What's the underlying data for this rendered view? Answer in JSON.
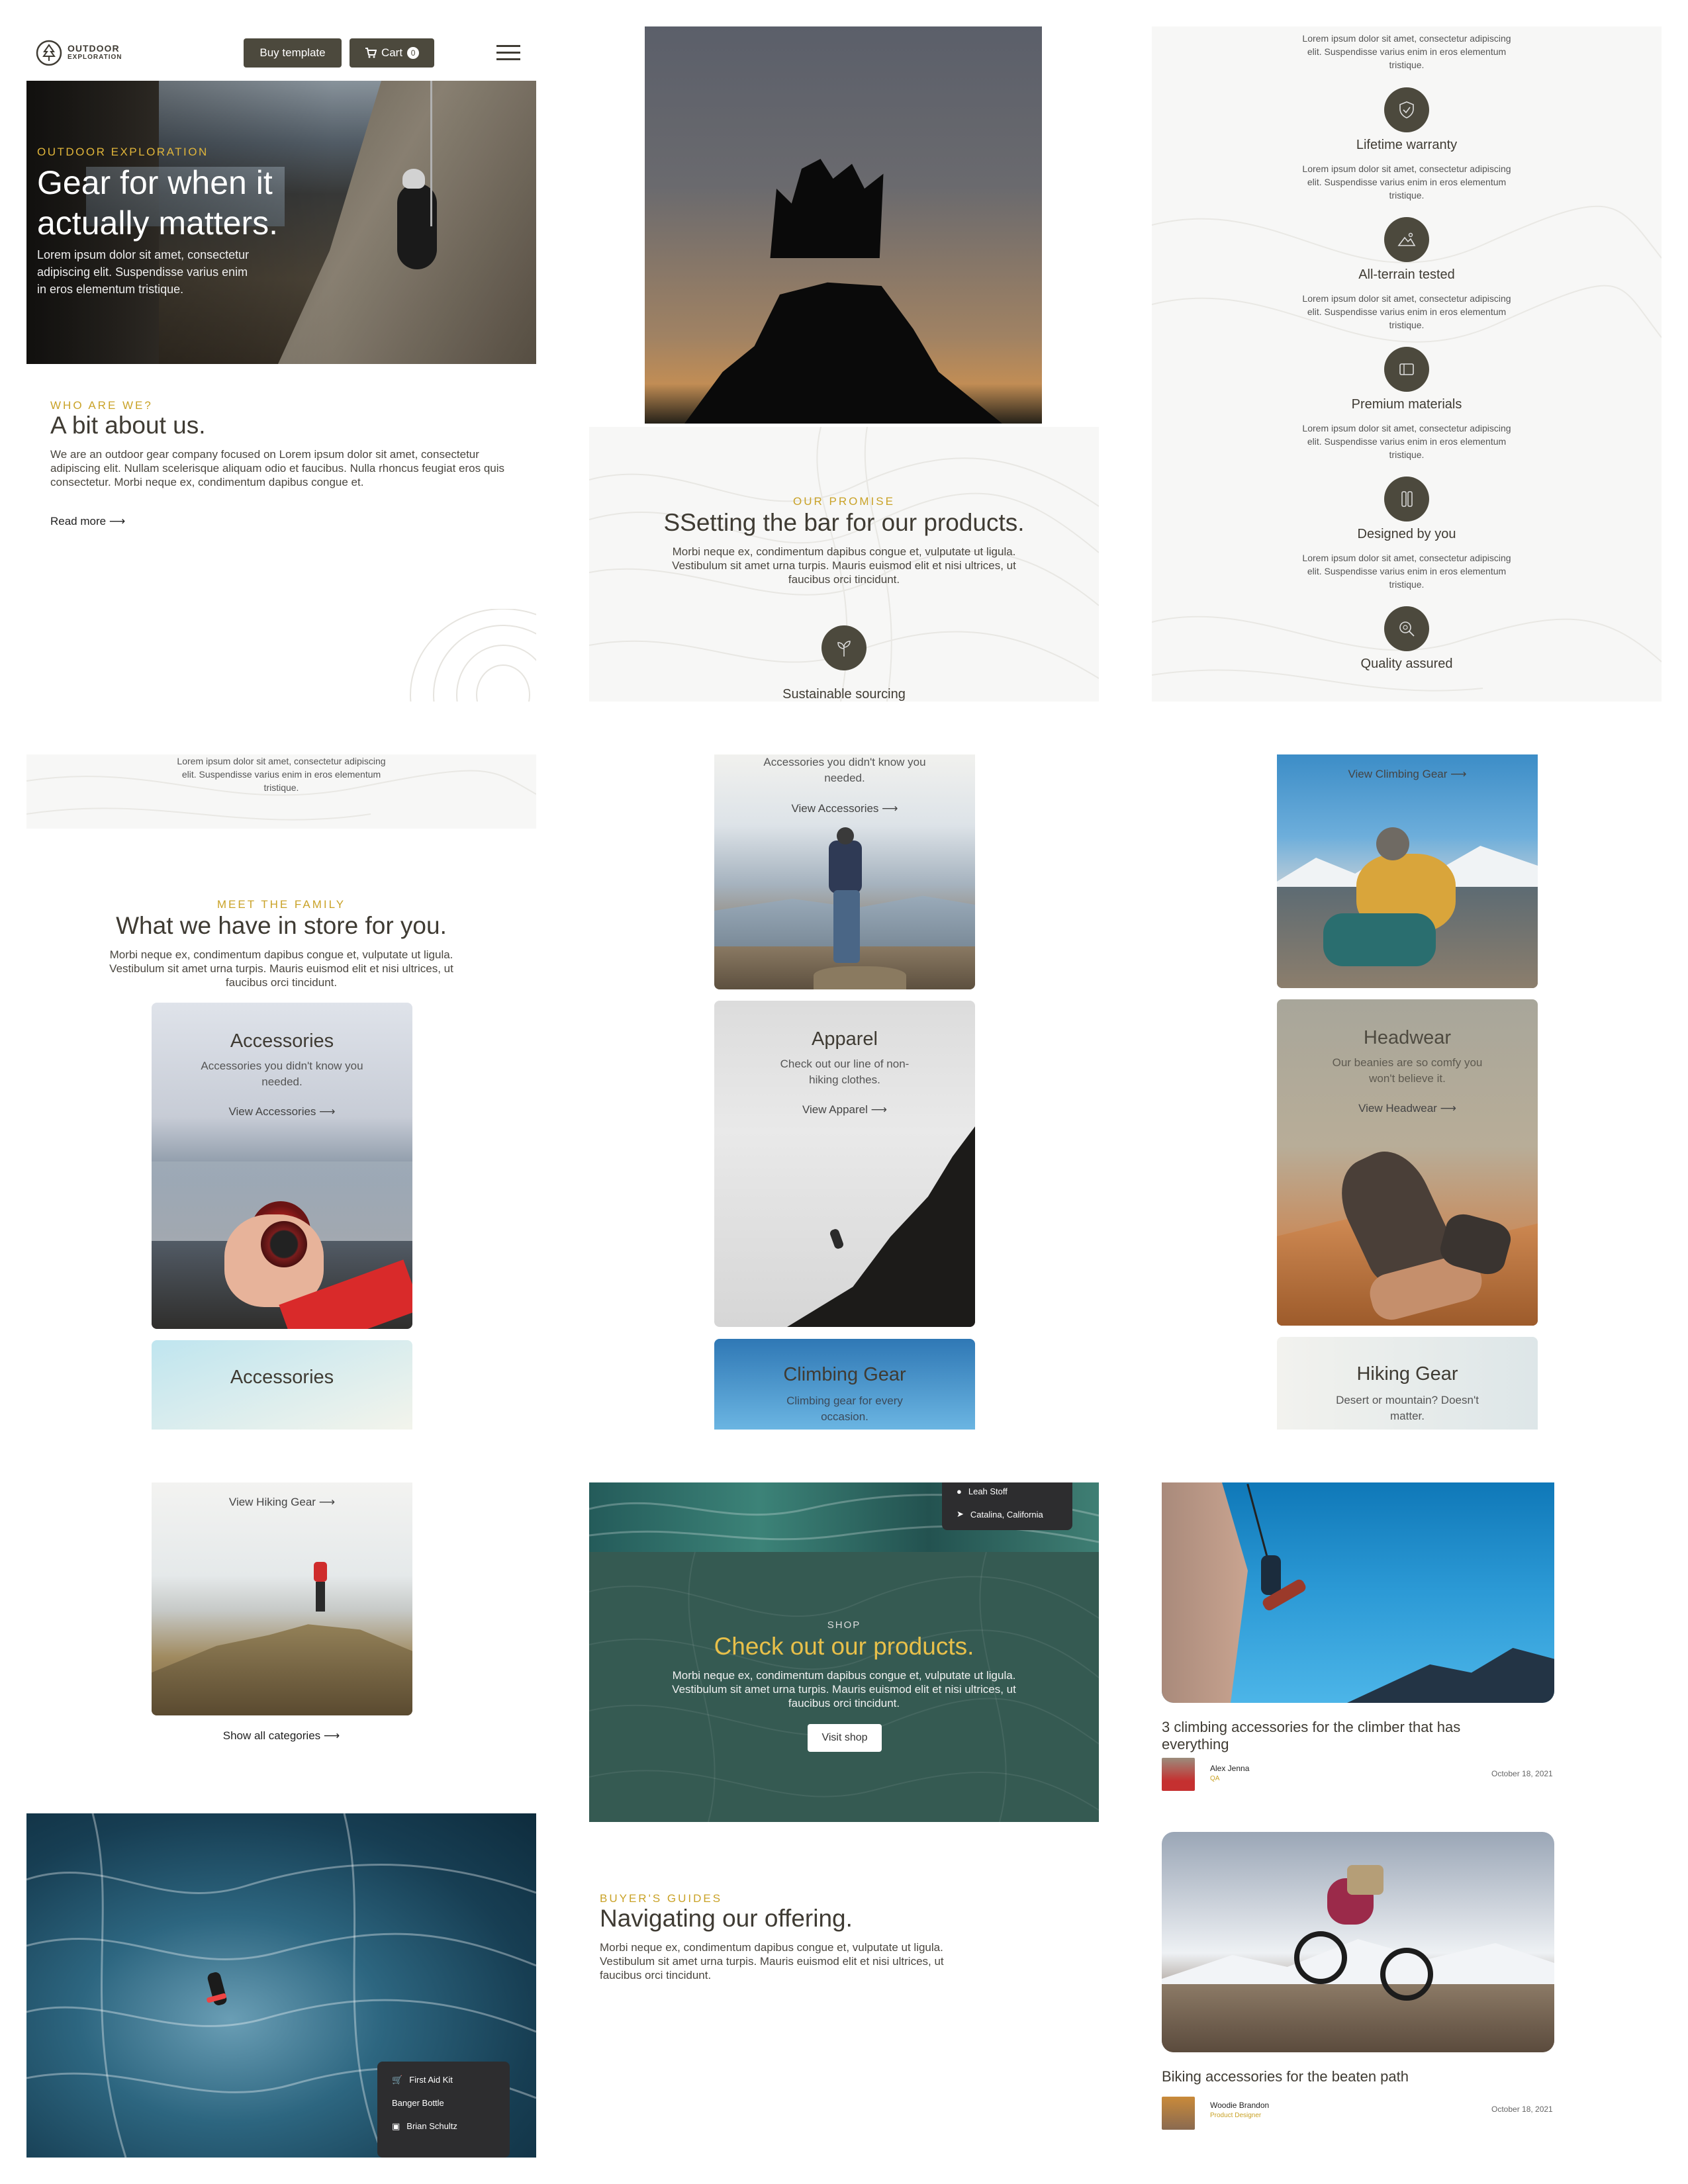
{
  "colors": {
    "accent": "#c9a227",
    "dark": "#4c493d",
    "forest": "#355a52"
  },
  "header": {
    "logo_top": "OUTDOOR",
    "logo_bottom": "EXPLORATION",
    "buy_label": "Buy template",
    "cart_label": "Cart",
    "cart_count": "0"
  },
  "hero": {
    "eyebrow": "OUTDOOR EXPLORATION",
    "title_line1": "Gear for when it",
    "title_line2": "actually matters.",
    "body_line1": "Lorem ipsum dolor sit amet, consectetur",
    "body_line2": "adipiscing elit. Suspendisse varius enim",
    "body_line3": "in eros elementum tristique."
  },
  "about": {
    "eyebrow": "WHO ARE WE?",
    "title": "A bit about us.",
    "body": "We are an outdoor gear company focused on Lorem ipsum dolor sit amet, consectetur adipiscing elit. Nullam scelerisque aliquam odio et faucibus. Nulla rhoncus feugiat eros quis consectetur. Morbi neque ex, condimentum dapibus congue et.",
    "link": "Read more"
  },
  "promise": {
    "eyebrow": "OUR PROMISE",
    "title": "SSetting the bar for our products.",
    "body": "Morbi neque ex, condimentum dapibus congue et, vulputate ut ligula. Vestibulum sit amet urna turpis. Mauris euismod elit et nisi ultrices, ut faucibus orci tincidunt.",
    "first_feature": "Sustainable sourcing"
  },
  "features": {
    "top_body": "Lorem ipsum dolor sit amet, consectetur adipiscing elit. Suspendisse varius enim in eros elementum tristique.",
    "items": [
      {
        "title": "Lifetime warranty",
        "icon": "shield-icon",
        "body": "Lorem ipsum dolor sit amet, consectetur adipiscing elit. Suspendisse varius enim in eros elementum tristique."
      },
      {
        "title": "All-terrain tested",
        "icon": "mountain-icon",
        "body": "Lorem ipsum dolor sit amet, consectetur adipiscing elit. Suspendisse varius enim in eros elementum tristique."
      },
      {
        "title": "Premium materials",
        "icon": "materials-icon",
        "body": "Lorem ipsum dolor sit amet, consectetur adipiscing elit. Suspendisse varius enim in eros elementum tristique."
      },
      {
        "title": "Designed by you",
        "icon": "pencil-icon",
        "body": "Lorem ipsum dolor sit amet, consectetur adipiscing elit. Suspendisse varius enim in eros elementum tristique."
      },
      {
        "title": "Quality assured",
        "icon": "magnifier-icon"
      }
    ],
    "overflow_body": "Lorem ipsum dolor sit amet, consectetur adipiscing elit. Suspendisse varius enim in eros elementum tristique."
  },
  "family": {
    "eyebrow": "MEET THE FAMILY",
    "title": "What we have in store for you.",
    "body": "Morbi neque ex, condimentum dapibus congue et, vulputate ut ligula. Vestibulum sit amet urna turpis. Mauris euismod elit et nisi ultrices, ut faucibus orci tincidunt."
  },
  "categories": {
    "accessories_top_sub": "Accessories you didn't know you needed.",
    "accessories_top_link": "View Accessories",
    "climbing_top_link": "View Climbing Gear",
    "accessories": {
      "title": "Accessories",
      "sub": "Accessories you didn't know you needed.",
      "link": "View Accessories"
    },
    "apparel": {
      "title": "Apparel",
      "sub": "Check out our line of non-hiking clothes.",
      "link": "View Apparel"
    },
    "headwear": {
      "title": "Headwear",
      "sub": "Our beanies are so comfy you won't believe it.",
      "link": "View Headwear"
    },
    "accessories_peek": "Accessories",
    "climbing": {
      "title": "Climbing Gear",
      "sub": "Climbing gear for every occasion."
    },
    "hiking": {
      "title": "Hiking Gear",
      "sub": "Desert or mountain? Doesn't matter."
    },
    "hiking_link": "View Hiking Gear",
    "show_all": "Show all categories"
  },
  "shop": {
    "eyebrow": "SHOP",
    "title": "Check out our products.",
    "body": "Morbi neque ex, condimentum dapibus congue et, vulputate ut ligula. Vestibulum sit amet urna turpis. Mauris euismod elit et nisi ultrices, ut faucibus orci tincidunt.",
    "button": "Visit shop",
    "popup_name": "Leah Stoff",
    "popup_location": "Catalina, California"
  },
  "ocean_popup": {
    "item1": "First Aid Kit",
    "item2": "Banger Bottle",
    "item3": "Brian Schultz"
  },
  "guides": {
    "eyebrow": "BUYER'S GUIDES",
    "title": "Navigating our offering.",
    "body": "Morbi neque ex, condimentum dapibus congue et, vulputate ut ligula. Vestibulum sit amet urna turpis. Mauris euismod elit et nisi ultrices, ut faucibus orci tincidunt."
  },
  "posts": [
    {
      "title": "3 climbing accessories for the climber that has everything",
      "author": "Alex Jenna",
      "role": "QA",
      "date": "October 18, 2021"
    },
    {
      "title": "Biking accessories for the beaten path",
      "author": "Woodie Brandon",
      "role": "Product Designer",
      "date": "October 18, 2021"
    }
  ]
}
